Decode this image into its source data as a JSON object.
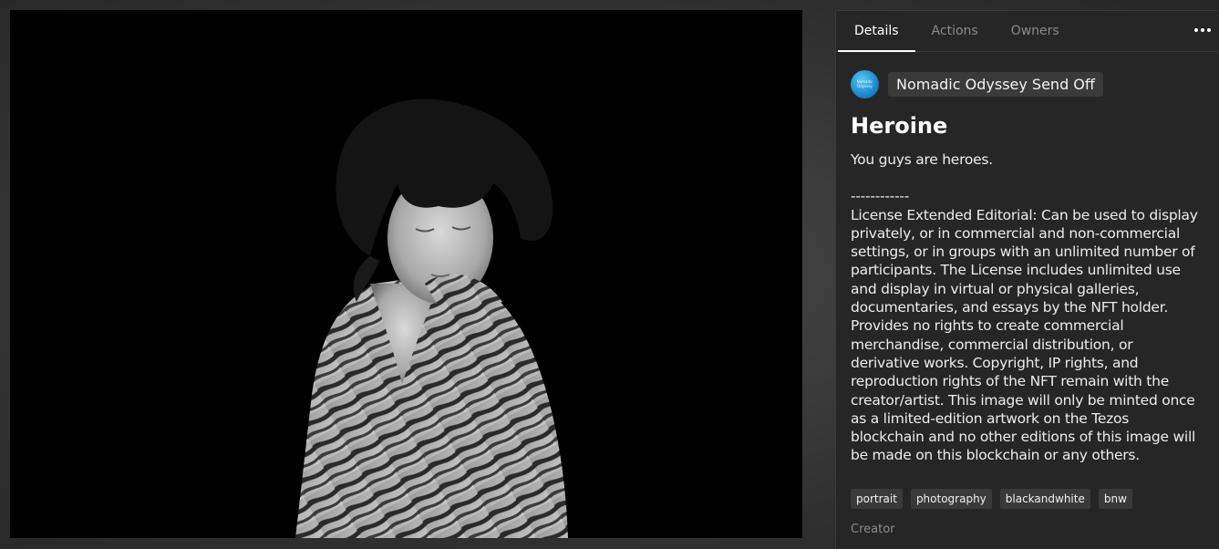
{
  "tabs": [
    {
      "label": "Details",
      "active": true
    },
    {
      "label": "Actions",
      "active": false
    },
    {
      "label": "Owners",
      "active": false
    }
  ],
  "collection": {
    "avatar_text": "Nomadic Odyssey",
    "name": "Nomadic Odyssey Send Off"
  },
  "token": {
    "title": "Heroine",
    "description_lead": "You guys are heroes.",
    "separator": "------------",
    "license": "License Extended Editorial: Can be used to display privately, or in commercial and non-commercial settings, or in groups with an unlimited number of participants. The License includes unlimited use and display in virtual or physical galleries, documentaries, and essays by the NFT holder. Provides no rights to create commercial merchandise, commercial distribution, or derivative works. Copyright, IP rights, and reproduction rights of the NFT remain with the creator/artist. This image will only be minted once as a limited-edition artwork on the Tezos blockchain and no other editions of this image will be made on this blockchain or any others."
  },
  "tags": [
    "portrait",
    "photography",
    "blackandwhite",
    "bnw"
  ],
  "creator_label": "Creator",
  "colors": {
    "panel_bg": "#262626",
    "tag_bg": "#3a3a3a",
    "accent_avatar": "#1c8fd0"
  },
  "icons": {
    "more": "more-horizontal-icon"
  }
}
